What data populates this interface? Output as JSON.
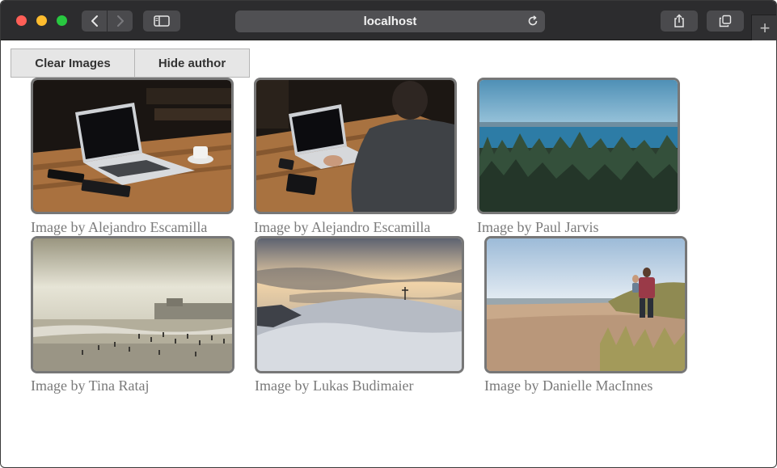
{
  "browser": {
    "url": "localhost",
    "icons": {
      "back": "chevron-left-icon",
      "forward": "chevron-right-icon",
      "sidebar": "sidebar-icon",
      "reload": "reload-icon",
      "share": "share-icon",
      "tabs": "tabs-overview-icon",
      "new_tab": "plus-icon"
    },
    "new_tab_glyph": "+"
  },
  "controls": {
    "clear_label": "Clear Images",
    "hide_label": "Hide author"
  },
  "images": [
    {
      "subject": "laptop on wooden table with coffee cup",
      "caption": "Image by Alejandro Escamilla"
    },
    {
      "subject": "person typing on laptop at wooden table",
      "caption": "Image by Alejandro Escamilla"
    },
    {
      "subject": "forest overlooking sea",
      "caption": "Image by Paul Jarvis"
    },
    {
      "subject": "crowded beach at hazy sunset",
      "caption": "Image by Tina Rataj"
    },
    {
      "subject": "snowy hill with cross at sunset",
      "caption": "Image by Lukas Budimaier"
    },
    {
      "subject": "man carrying child on beach",
      "caption": "Image by Danielle MacInnes"
    }
  ],
  "colors": {
    "toolbar": "#2c2c2e",
    "button_bg": "#e6e6e6",
    "caption": "#7a7a7a",
    "image_border": "#777777"
  }
}
